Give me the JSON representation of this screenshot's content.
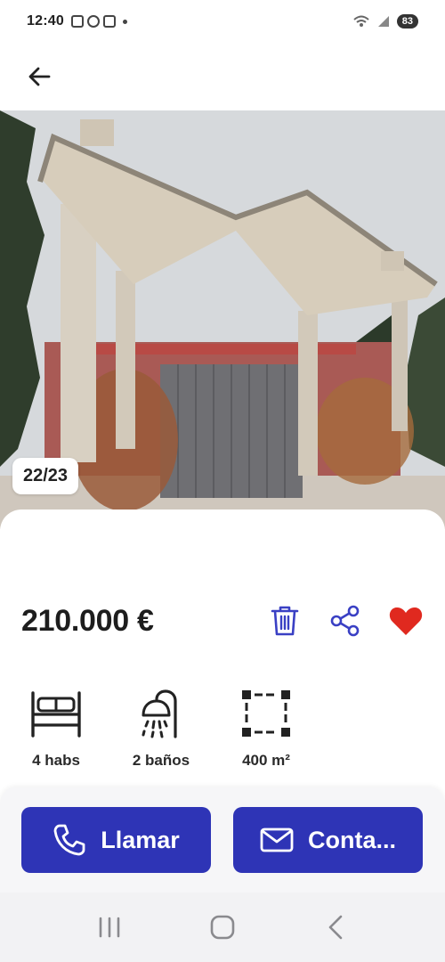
{
  "status_bar": {
    "time": "12:40",
    "battery": "83"
  },
  "top_bar": {
    "back_icon": "arrow-left-icon"
  },
  "gallery": {
    "counter": "22/23"
  },
  "listing": {
    "price": "210.000 €",
    "actions": [
      {
        "name": "delete",
        "icon": "trash-icon"
      },
      {
        "name": "share",
        "icon": "share-icon"
      },
      {
        "name": "favorite",
        "icon": "heart-icon",
        "active": true
      }
    ],
    "features": [
      {
        "icon": "bed-icon",
        "label": "4 habs"
      },
      {
        "icon": "shower-icon",
        "label": "2 baños"
      },
      {
        "icon": "area-icon",
        "label": "400 m²"
      }
    ]
  },
  "cta": {
    "call_label": "Llamar",
    "contact_label": "Conta..."
  },
  "colors": {
    "accent": "#2e34b6",
    "icon_blue": "#3a40c4",
    "heart_red": "#e0291f"
  },
  "nav": {
    "items": [
      "recent-apps-icon",
      "home-icon",
      "back-icon"
    ]
  }
}
